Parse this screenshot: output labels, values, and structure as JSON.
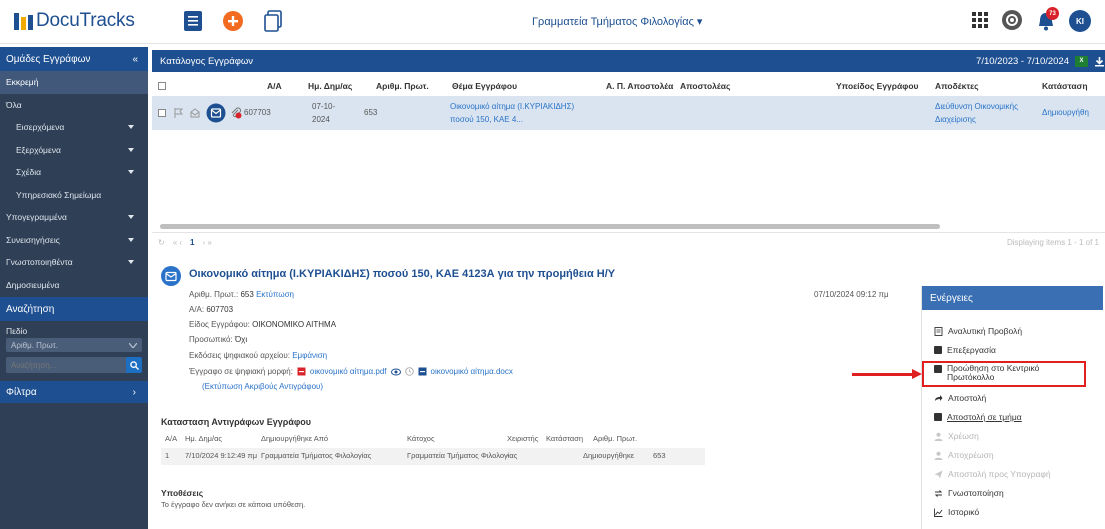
{
  "app": {
    "logo_text": "DocuTracks",
    "org_name": "Γραμματεία Τμήματος Φιλολογίας ▾",
    "notif_count": "73",
    "user_initials": "KI"
  },
  "sidebar": {
    "header": "Ομάδες Εγγράφων",
    "collapse": "«",
    "items": [
      {
        "label": "Εκκρεμή"
      },
      {
        "label": "Όλα"
      },
      {
        "label": "Εισερχόμενα"
      },
      {
        "label": "Εξερχόμενα"
      },
      {
        "label": "Σχέδια"
      },
      {
        "label": "Υπηρεσιακό Σημείωμα"
      },
      {
        "label": "Υπογεγραμμένα"
      },
      {
        "label": "Συνεισηγήσεις"
      },
      {
        "label": "Γνωστοποιηθέντα"
      },
      {
        "label": "Δημοσιευμένα"
      }
    ],
    "search_header": "Αναζήτηση",
    "field_label": "Πεδίο",
    "field_value": "Αριθμ. Πρωτ.",
    "search_placeholder": "Αναζήτηση...",
    "filters": "Φίλτρα",
    "filters_arrow": "›"
  },
  "list": {
    "title": "Κατάλογος Εγγράφων",
    "date_range": "7/10/2023 - 7/10/2024",
    "xls": "X",
    "columns": {
      "aa": "Α/Α",
      "date": "Ημ. Δημ/ας",
      "prot": "Αριθμ. Πρωτ.",
      "subject": "Θέμα Εγγράφου",
      "sender_prot": "Α. Π. Αποστολέα",
      "sender": "Αποστολέας",
      "subtype": "Υποείδος Εγγράφου",
      "recipients": "Αποδέκτες",
      "status": "Κατάσταση"
    },
    "row": {
      "aa": "607703",
      "date_line1": "07-10-",
      "date_line2": "2024",
      "prot": "653",
      "subject_line1": "Οικονομικό αίτημα (Ι.ΚΥΡΙΑΚΙΔΗΣ)",
      "subject_line2": "ποσού 150, ΚΑΕ 4...",
      "recipients_line1": "Διεύθυνση Οικονομικής",
      "recipients_line2": "Διαχείρισης",
      "status": "Δημιουργήθη"
    },
    "pager": {
      "refresh": "↻",
      "nav_left": "« ‹",
      "page": "1",
      "nav_right": "› »",
      "info": "Displaying items 1 - 1 of 1"
    }
  },
  "detail": {
    "title": "Οικονομικό αίτημα (Ι.ΚΥΡΙΑΚΙΔΗΣ) ποσού 150, ΚΑΕ 4123Α για την προμήθεια Η/Υ",
    "date": "07/10/2024 09:12 πμ",
    "prot_label": "Αριθμ. Πρωτ.:",
    "prot_value": "653",
    "prot_print": "Εκτύπωση",
    "aa_label": "Α/Α:",
    "aa_value": "607703",
    "type_label": "Είδος Εγγράφου:",
    "type_value": "ΟΙΚΟΝΟΜΙΚΟ ΑΙΤΗΜΑ",
    "personal_label": "Προσωπικό:",
    "personal_value": "Όχι",
    "versions_label": "Εκδόσεις ψηφιακού αρχείου:",
    "versions_value": "Εμφάνιση",
    "digital_label": "Έγγραφο σε ψηφιακή μορφή:",
    "file_pdf": "οικονομικό αίτημα.pdf",
    "file_docx": "οικονομικό αίτημα.docx",
    "print_copy": "(Εκτύπωση Ακριβούς Αντιγράφου)"
  },
  "copies": {
    "title": "Κατασταση Αντιγράφων Εγγράφου",
    "headers": [
      "Α/Α",
      "Ημ. Δημ/ας",
      "Δημιουργήθηκε Από",
      "Κάτοχος",
      "Χειριστής",
      "Κατάσταση",
      "Αριθμ. Πρωτ."
    ],
    "row": [
      "1",
      "7/10/2024 9:12:49 πμ",
      "Γραμματεία Τμήματος Φιλολογίας",
      "Γραμματεία Τμήματος Φιλολογίας",
      "-",
      "Δημιουργήθηκε",
      "653"
    ]
  },
  "cases": {
    "title": "Υποθέσεις",
    "text": "Το έγγραφο δεν ανήκει σε κάποια υπόθεση."
  },
  "actions": {
    "title": "Ενέργειες",
    "items": [
      {
        "label": "Αναλυτική Προβολή"
      },
      {
        "label": "Επεξεργασία"
      },
      {
        "label": "Προώθηση στο Κεντρικό",
        "label2": "Πρωτόκολλο"
      },
      {
        "label": "Αποστολή"
      },
      {
        "label": "Αποστολή σε τμήμα"
      },
      {
        "label": "Χρέωση"
      },
      {
        "label": "Αποχρέωση"
      },
      {
        "label": "Αποστολή προς Υπογραφή"
      },
      {
        "label": "Γνωστοποίηση"
      },
      {
        "label": "Ιστορικό"
      }
    ]
  },
  "colors": {
    "primary": "#1d4f91",
    "sidebar": "#2f3f55",
    "highlight": "#e02020",
    "link": "#2a73c8",
    "orange": "#f26b21"
  }
}
